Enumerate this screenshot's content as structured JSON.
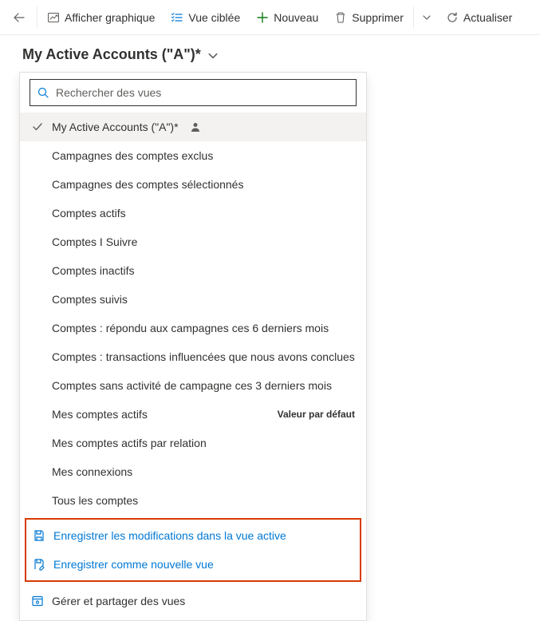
{
  "toolbar": {
    "show_chart": "Afficher graphique",
    "focused_view": "Vue ciblée",
    "new": "Nouveau",
    "delete": "Supprimer",
    "refresh": "Actualiser"
  },
  "title": "My Active Accounts (\"A\")*",
  "search": {
    "placeholder": "Rechercher des vues"
  },
  "views": [
    {
      "label": "My Active Accounts (\"A\")*",
      "selected": true,
      "personal": true
    },
    {
      "label": "Campagnes des comptes exclus"
    },
    {
      "label": "Campagnes des comptes sélectionnés"
    },
    {
      "label": "Comptes actifs"
    },
    {
      "label": "Comptes I Suivre"
    },
    {
      "label": "Comptes inactifs"
    },
    {
      "label": "Comptes suivis"
    },
    {
      "label": "Comptes : répondu aux campagnes ces 6 derniers mois"
    },
    {
      "label": "Comptes : transactions influencées que nous avons conclues"
    },
    {
      "label": "Comptes sans activité de campagne ces 3 derniers mois"
    },
    {
      "label": "Mes comptes actifs",
      "default": true
    },
    {
      "label": "Mes comptes actifs par relation"
    },
    {
      "label": "Mes connexions"
    },
    {
      "label": "Tous les comptes"
    }
  ],
  "default_badge": "Valeur par défaut",
  "actions": {
    "save_current": "Enregistrer les modifications dans la vue active",
    "save_as_new": "Enregistrer comme nouvelle vue",
    "manage": "Gérer et partager des vues"
  }
}
